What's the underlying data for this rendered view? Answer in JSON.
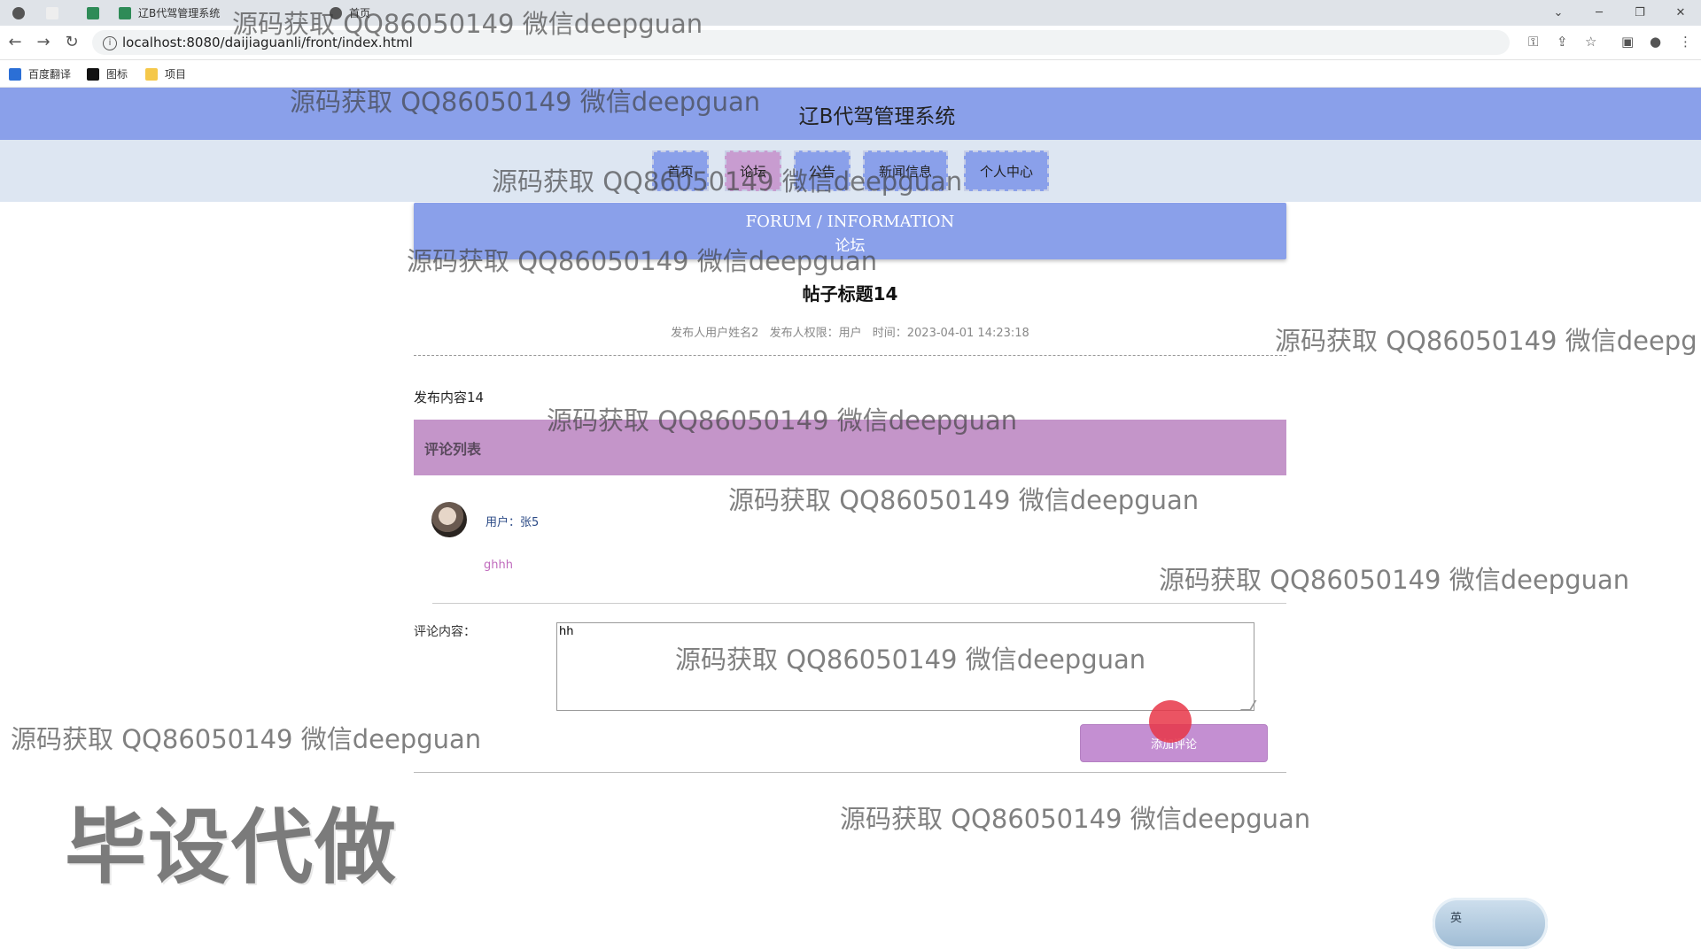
{
  "browser": {
    "tabs": [
      {
        "label": ""
      },
      {
        "label": ""
      },
      {
        "label": "辽B代驾管理系统"
      },
      {
        "label": "首页"
      }
    ],
    "url": "localhost:8080/daijiaguanli/front/index.html",
    "bookmarks": [
      "百度翻译",
      "图标",
      "项目"
    ]
  },
  "header": {
    "title": "辽B代驾管理系统"
  },
  "nav": {
    "items": [
      {
        "label": "首页"
      },
      {
        "label": "论坛"
      },
      {
        "label": "公告"
      },
      {
        "label": "新闻信息"
      },
      {
        "label": "个人中心"
      }
    ]
  },
  "banner": {
    "en": "FORUM / INFORMATION",
    "cn": "论坛"
  },
  "post": {
    "title": "帖子标题14",
    "author": "发布人用户姓名2",
    "role": "发布人权限：用户",
    "time": "时间：2023-04-01 14:23:18",
    "content": "发布内容14"
  },
  "comments": {
    "header": "评论列表",
    "items": [
      {
        "user": "用户：张5",
        "text": "ghhh"
      }
    ]
  },
  "form": {
    "label": "评论内容：",
    "value": "hh",
    "submit": "添加评论"
  },
  "watermarks": {
    "text": "源码获取 QQ86050149 微信deepguan",
    "text_cut": "源码获取 QQ86050149 微信deepg",
    "big": "毕设代做"
  },
  "ime": {
    "label": "英"
  },
  "colors": {
    "primary": "#8aa0ea",
    "accent": "#c495c9"
  }
}
